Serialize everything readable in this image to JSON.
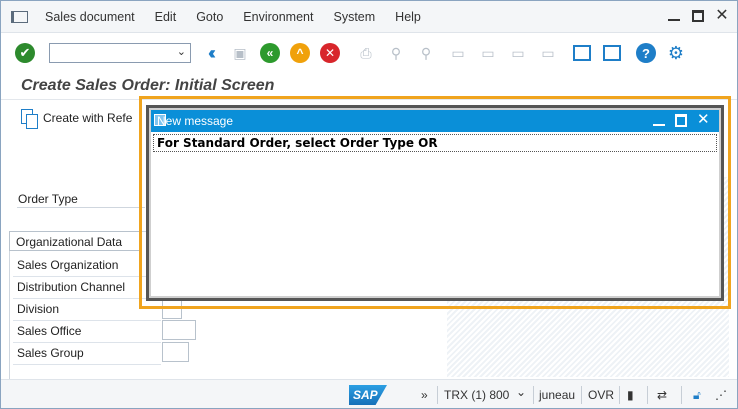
{
  "menubar": {
    "items": [
      "Sales document",
      "Edit",
      "Goto",
      "Environment",
      "System",
      "Help"
    ]
  },
  "toolbar": {
    "command_value": "",
    "icons": [
      "enter-icon",
      "command-dropdown-icon",
      "back-double-chevron-icon",
      "save-icon",
      "back-icon",
      "exit-icon",
      "cancel-icon",
      "print-icon",
      "find-icon",
      "find-next-icon",
      "first-page-icon",
      "previous-page-icon",
      "next-page-icon",
      "last-page-icon",
      "create-session-icon",
      "generate-shortcut-icon",
      "help-icon",
      "customize-layout-icon"
    ]
  },
  "screen": {
    "title": "Create Sales Order: Initial Screen",
    "create_with_reference": "Create with Refe"
  },
  "form": {
    "order_type_label": "Order Type",
    "org_tab_label": "Organizational Data",
    "fields": {
      "sales_org": "Sales Organization",
      "dist_channel": "Distribution Channel",
      "division": "Division",
      "sales_office": "Sales Office",
      "sales_group": "Sales Group"
    }
  },
  "modal": {
    "title": "New message",
    "message": "For Standard Order, select Order Type OR"
  },
  "statusbar": {
    "more": "»",
    "system": "TRX (1) 800",
    "user": "juneau",
    "mode": "OVR"
  },
  "colors": {
    "modal_title_bg": "#0a8fd8",
    "highlight": "#f0a41e",
    "sap_blue": "#1e7ec8"
  }
}
